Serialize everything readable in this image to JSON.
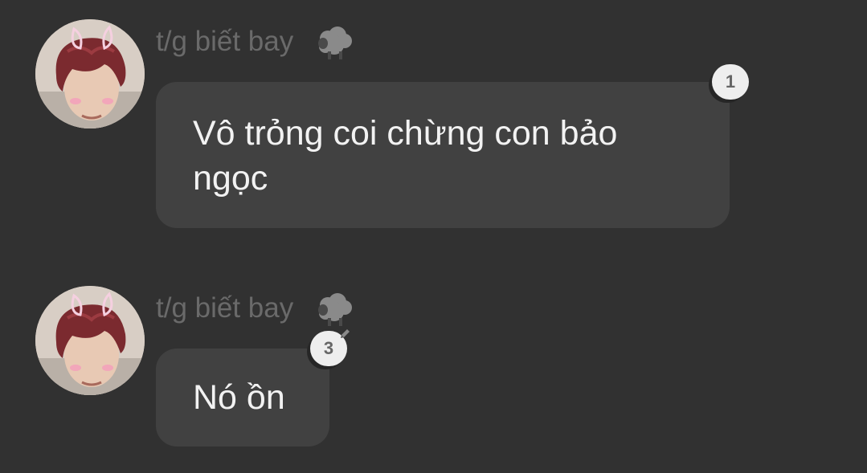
{
  "messages": [
    {
      "sender": "t/g biết bay",
      "sender_icon": "sheep-icon",
      "avatar": "user-avatar",
      "text": "Vô trỏng coi chừng con bảo ngọc",
      "reaction_count": "1"
    },
    {
      "sender": "t/g biết bay",
      "sender_icon": "sheep-icon",
      "avatar": "user-avatar",
      "text": "Nó ồn",
      "reaction_count": "3",
      "badge_icon": "edit-icon"
    }
  ],
  "colors": {
    "background": "#313131",
    "bubble": "#414141",
    "message_text": "#f2f2f2",
    "sender_text": "#6a6a6a",
    "badge": "#eeeeee"
  }
}
